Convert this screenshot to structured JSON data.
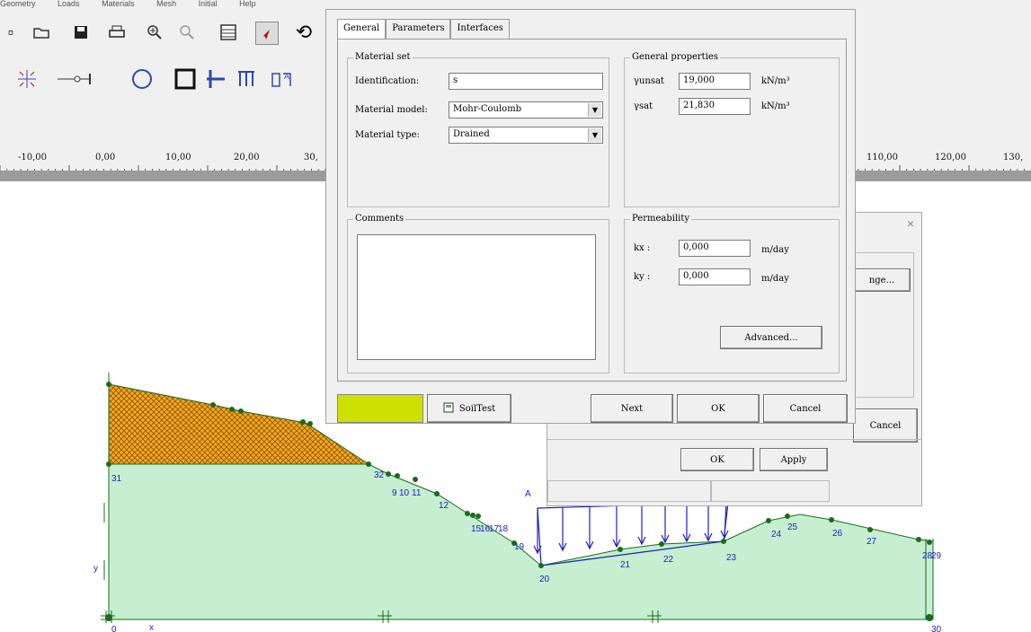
{
  "menu": [
    "Geometry",
    "Loads",
    "Materials",
    "Mesh",
    "Initial",
    "Help"
  ],
  "ruler": {
    "labels": [
      "-10,00",
      "0,00",
      "10,00",
      "20,00",
      "30,",
      "110,00",
      "120,00",
      "130,"
    ]
  },
  "material_dialog": {
    "tabs": [
      "General",
      "Parameters",
      "Interfaces"
    ],
    "material_set": {
      "title": "Material set",
      "identification_label": "Identification:",
      "identification_value": "s",
      "model_label": "Material model:",
      "model_value": "Mohr-Coulomb",
      "type_label": "Material type:",
      "type_value": "Drained"
    },
    "general_properties": {
      "title": "General properties",
      "gamma_unsat_label": "γunsat",
      "gamma_unsat_value": "19,000",
      "gamma_sat_label": "γsat",
      "gamma_sat_value": "21,830",
      "unit": "kN/m³"
    },
    "comments": {
      "title": "Comments",
      "value": ""
    },
    "permeability": {
      "title": "Permeability",
      "kx_label": "kx :",
      "kx_value": "0,000",
      "ky_label": "ky :",
      "ky_value": "0,000",
      "unit": "m/day",
      "advanced_label": "Advanced..."
    },
    "color_swatch": "#cde000",
    "soiltest_label": "SoilTest",
    "next_label": "Next",
    "ok_label": "OK",
    "cancel_label": "Cancel"
  },
  "back_dialog": {
    "change_label": "nge...",
    "cancel_label": "Cancel",
    "ok_label": "OK",
    "apply_label": "Apply"
  },
  "model": {
    "load_label": "A",
    "point_labels": [
      "0",
      "31",
      "32",
      "9",
      "10",
      "11",
      "12",
      "15",
      "16",
      "17",
      "18",
      "19",
      "20",
      "21",
      "22",
      "23",
      "24",
      "25",
      "26",
      "27",
      "28",
      "29",
      "30"
    ],
    "axis_x_label": "x",
    "axis_y_label": "y",
    "soil_color": "#c5efd0",
    "fill_color": "#f4a620"
  }
}
